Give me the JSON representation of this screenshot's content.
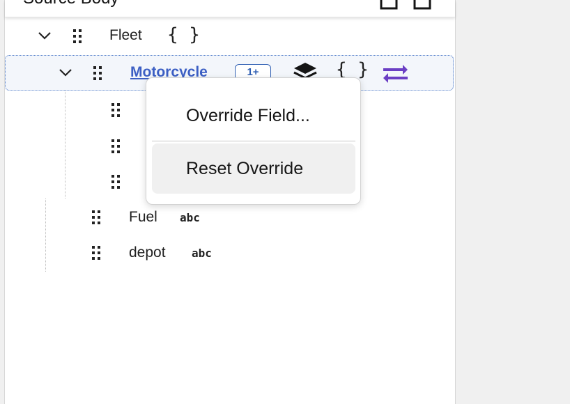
{
  "panel": {
    "title": "Source Body"
  },
  "tree": {
    "fleet": {
      "label": "Fleet",
      "type_icon": "{ }"
    },
    "motorcycle": {
      "label": "Motorcycle",
      "badge": "1+",
      "type_icon": "{ }",
      "accent_color": "#3c5fc4",
      "transform_color": "#6b3fc4"
    },
    "fuel": {
      "label": "Fuel",
      "type_icon": "abc"
    },
    "depot": {
      "label": "depot",
      "type_icon": "abc"
    }
  },
  "context_menu": {
    "items": [
      {
        "label": "Override Field..."
      },
      {
        "label": "Reset Override"
      }
    ]
  }
}
